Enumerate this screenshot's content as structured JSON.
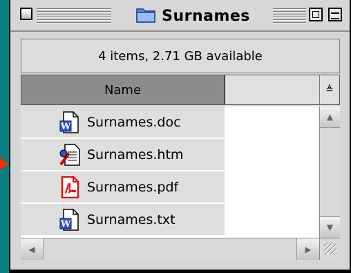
{
  "window": {
    "title": "Surnames"
  },
  "info": {
    "summary": "4 items, 2.71 GB available"
  },
  "columns": {
    "name_header": "Name",
    "sort_glyph": "≜"
  },
  "files": [
    {
      "name": "Surnames.doc",
      "icon": "word-doc-icon"
    },
    {
      "name": "Surnames.htm",
      "icon": "html-doc-icon"
    },
    {
      "name": "Surnames.pdf",
      "icon": "pdf-doc-icon"
    },
    {
      "name": "Surnames.txt",
      "icon": "word-doc-icon"
    }
  ],
  "colors": {
    "desktop": "#0b7f80",
    "header_selected": "#8d8d8d",
    "pdf_red": "#e30b0b",
    "folder_blue": "#5f8fd9"
  }
}
